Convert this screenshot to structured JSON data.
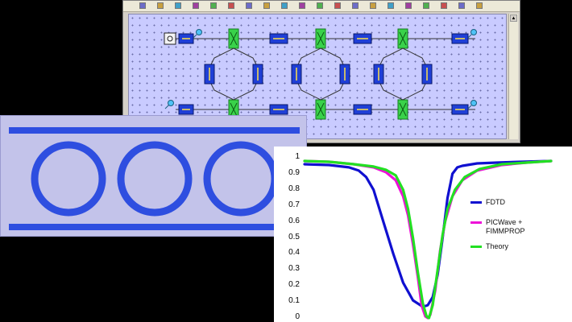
{
  "schematic": {
    "toolbar_icons": [
      "tool-icon",
      "tool-icon",
      "tool-icon",
      "tool-icon",
      "tool-icon",
      "tool-icon",
      "tool-icon",
      "tool-icon",
      "tool-icon",
      "tool-icon",
      "tool-icon",
      "tool-icon",
      "tool-icon",
      "tool-icon",
      "tool-icon",
      "tool-icon",
      "tool-icon",
      "tool-icon",
      "tool-icon",
      "tool-icon"
    ],
    "colors": {
      "component": "#1f3fd6",
      "coupler": "#39d24a",
      "port": "#4fc3f7",
      "wire": "#333333"
    }
  },
  "layout_panel": {
    "colors": {
      "waveguide": "#2e4ee0",
      "background": "#c3c3ea"
    },
    "ring_count": 3
  },
  "plot": {
    "y_ticks": [
      "1",
      "0.9",
      "0.8",
      "0.7",
      "0.6",
      "0.5",
      "0.4",
      "0.3",
      "0.2",
      "0.1",
      "0"
    ],
    "legend": [
      {
        "label": "FDTD",
        "color": "#1010d0"
      },
      {
        "label": "PICWave +\nFIMMPROP",
        "color": "#ee10d8"
      },
      {
        "label": "Theory",
        "color": "#22e022"
      }
    ]
  },
  "chart_data": {
    "type": "line",
    "ylim": [
      0,
      1
    ],
    "xlim": [
      0,
      100
    ],
    "title": "",
    "xlabel": "",
    "ylabel": "",
    "legend_position": "right",
    "series": [
      {
        "name": "FDTD",
        "color": "#1010d0",
        "x": [
          0,
          10,
          18,
          22,
          25,
          28,
          32,
          36,
          40,
          44,
          48,
          50,
          52,
          54,
          56,
          58,
          60,
          62,
          64,
          66,
          70,
          78,
          88,
          100
        ],
        "y": [
          0.96,
          0.955,
          0.94,
          0.92,
          0.88,
          0.8,
          0.6,
          0.4,
          0.22,
          0.11,
          0.07,
          0.08,
          0.13,
          0.27,
          0.5,
          0.75,
          0.9,
          0.94,
          0.95,
          0.955,
          0.965,
          0.97,
          0.975,
          0.98
        ]
      },
      {
        "name": "PICWave +\nFIMMPROP",
        "color": "#ee10d8",
        "x": [
          0,
          10,
          20,
          28,
          33,
          37,
          40,
          42,
          44,
          46,
          47.5,
          49,
          50,
          51,
          53,
          55,
          57,
          60,
          64,
          70,
          80,
          90,
          100
        ],
        "y": [
          0.98,
          0.975,
          0.96,
          0.94,
          0.91,
          0.86,
          0.76,
          0.64,
          0.46,
          0.25,
          0.08,
          0.01,
          0.0,
          0.02,
          0.17,
          0.42,
          0.6,
          0.76,
          0.86,
          0.92,
          0.955,
          0.97,
          0.98
        ]
      },
      {
        "name": "Theory",
        "color": "#22e022",
        "x": [
          0,
          10,
          20,
          28,
          33,
          37,
          40,
          42,
          44,
          46,
          48,
          49.5,
          50.5,
          52,
          54,
          56,
          58,
          61,
          65,
          71,
          80,
          90,
          100
        ],
        "y": [
          0.98,
          0.975,
          0.96,
          0.945,
          0.925,
          0.89,
          0.8,
          0.68,
          0.5,
          0.28,
          0.09,
          0.01,
          0.0,
          0.08,
          0.3,
          0.52,
          0.68,
          0.8,
          0.88,
          0.93,
          0.96,
          0.97,
          0.98
        ]
      }
    ]
  }
}
